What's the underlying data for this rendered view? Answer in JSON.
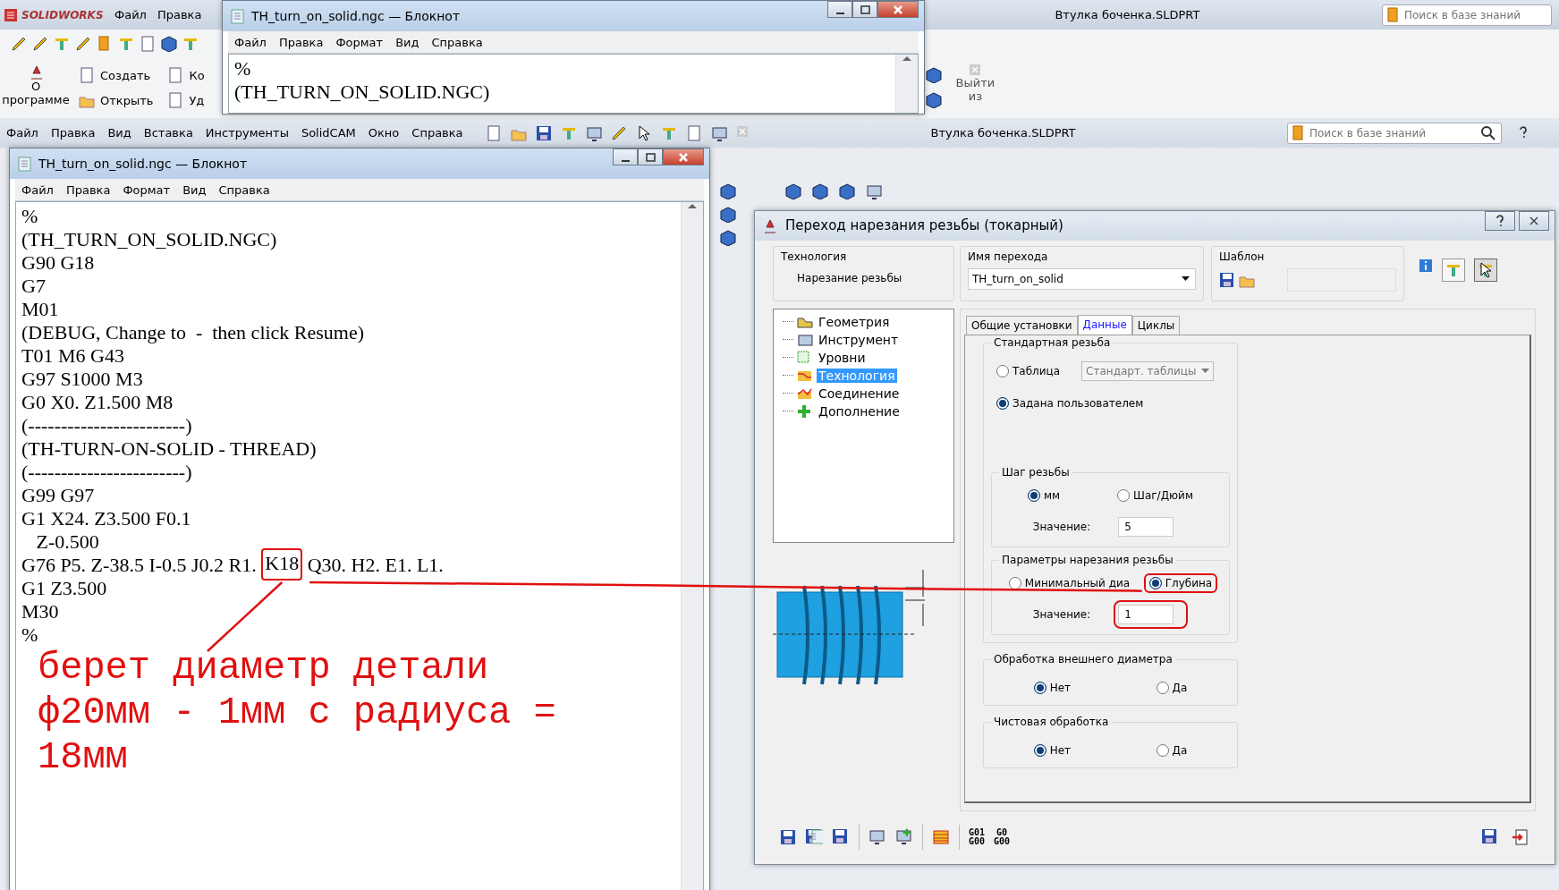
{
  "back_app": {
    "logo": "SOLIDWORKS",
    "menu": [
      "Файл",
      "Правка"
    ],
    "title": "Втулка боченка.SLDPRT",
    "search": {
      "placeholder": "Поиск в базе знаний"
    },
    "ribbon": [
      "Создать",
      "Открыть"
    ],
    "ribbon_cut": [
      "Ко",
      "Уд"
    ],
    "about": "О",
    "about_cut": "программе",
    "exit": [
      "Выйти",
      "из"
    ]
  },
  "back_notepad": {
    "title": "TH_turn_on_solid.ngc — Блокнот",
    "menu": [
      "Файл",
      "Правка",
      "Формат",
      "Вид",
      "Справка"
    ],
    "lines": [
      "%",
      "(TH_TURN_ON_SOLID.NGC)"
    ]
  },
  "app": {
    "menu": [
      "Файл",
      "Правка",
      "Вид",
      "Вставка",
      "Инструменты",
      "SolidCAM",
      "Окно",
      "Справка"
    ],
    "title": "Втулка боченка.SLDPRT",
    "search": {
      "placeholder": "Поиск в базе знаний"
    }
  },
  "notepad": {
    "title": "TH_turn_on_solid.ngc — Блокнот",
    "menu": [
      "Файл",
      "Правка",
      "Формат",
      "Вид",
      "Справка"
    ],
    "lines": [
      {
        "parts": [
          "%"
        ]
      },
      {
        "parts": [
          "(TH_TURN_ON_SOLID.NGC)"
        ]
      },
      {
        "parts": [
          "G90 G18"
        ]
      },
      {
        "parts": [
          "G7"
        ]
      },
      {
        "parts": [
          "M01"
        ]
      },
      {
        "parts": [
          "(DEBUG, Change to  -  then click Resume)"
        ]
      },
      {
        "parts": [
          "T01 M6 G43"
        ]
      },
      {
        "parts": [
          "G97 S1000 M3"
        ]
      },
      {
        "parts": [
          "G0 X0. Z1.500 M8"
        ]
      },
      {
        "parts": [
          "(------------------------)"
        ]
      },
      {
        "parts": [
          "(TH-TURN-ON-SOLID - THREAD)"
        ]
      },
      {
        "parts": [
          "(------------------------)"
        ]
      },
      {
        "parts": [
          "G99 G97"
        ]
      },
      {
        "parts": [
          "G1 X24. Z3.500 F0.1"
        ]
      },
      {
        "parts": [
          "   Z-0.500"
        ]
      },
      {
        "parts": [
          "G76 P5. Z-38.5 I-0.5 J0.2 R1. ",
          "K18",
          " Q30. H2. E1. L1."
        ],
        "circled": [
          false,
          true,
          false
        ]
      },
      {
        "parts": [
          "G1 Z3.500"
        ]
      },
      {
        "parts": [
          "M30"
        ]
      },
      {
        "parts": [
          "%"
        ]
      }
    ]
  },
  "annotation": {
    "note_lines": [
      "берет диаметр детали",
      "ф20мм - 1мм с радиуса =",
      "18мм"
    ]
  },
  "dialog": {
    "title": "Переход нарезания резьбы (токарный)",
    "technology": {
      "label": "Технология",
      "value": "Нарезание резьбы"
    },
    "operation_name": {
      "label": "Имя перехода",
      "value": "TH_turn_on_solid"
    },
    "template": {
      "label": "Шаблон"
    },
    "tree": [
      {
        "label": "Геометрия",
        "selected": false
      },
      {
        "label": "Инструмент",
        "selected": false
      },
      {
        "label": "Уровни",
        "selected": false
      },
      {
        "label": "Технология",
        "selected": true
      },
      {
        "label": "Соединение",
        "selected": false
      },
      {
        "label": "Дополнение",
        "selected": false
      }
    ],
    "tabs": [
      {
        "label": "Общие установки",
        "selected": false
      },
      {
        "label": "Данные",
        "selected": true
      },
      {
        "label": "Циклы",
        "selected": false
      }
    ],
    "sections": [
      {
        "title": "Стандартная резьба",
        "items": [
          {
            "kind": "radio_dropdown",
            "label": "Таблица",
            "checked": false,
            "dropdown": "Стандарт. таблицы",
            "disabled": true
          },
          {
            "kind": "radio",
            "label": "Задана пользователем",
            "checked": true
          },
          {
            "kind": "group",
            "title": "Шаг резьбы",
            "items": [
              {
                "kind": "radio_pair",
                "options": [
                  {
                    "label": "мм",
                    "checked": true,
                    "circled": false
                  },
                  {
                    "label": "Шаг/Дюйм",
                    "checked": false,
                    "circled": false
                  }
                ]
              },
              {
                "kind": "value",
                "label": "Значение:",
                "value": "5",
                "circled": false
              }
            ]
          },
          {
            "kind": "group",
            "title": "Параметры нарезания резьбы",
            "items": [
              {
                "kind": "radio_pair",
                "options": [
                  {
                    "label": "Минимальный диа",
                    "checked": false,
                    "circled": false
                  },
                  {
                    "label": "Глубина",
                    "checked": true,
                    "circled": true
                  }
                ]
              },
              {
                "kind": "value",
                "label": "Значение:",
                "value": "1",
                "circled": true
              }
            ]
          }
        ]
      },
      {
        "title": "Обработка внешнего диаметра",
        "items": [
          {
            "kind": "radio_pair",
            "options": [
              {
                "label": "Нет",
                "checked": true,
                "circled": false
              },
              {
                "label": "Да",
                "checked": false,
                "circled": false
              }
            ]
          }
        ]
      },
      {
        "title": "Чистовая обработка",
        "items": [
          {
            "kind": "radio_pair",
            "options": [
              {
                "label": "Нет",
                "checked": true,
                "circled": false
              },
              {
                "label": "Да",
                "checked": false,
                "circled": false
              }
            ]
          }
        ]
      }
    ],
    "gcode_buttons": [
      {
        "top": "G01",
        "bottom": "G00"
      },
      {
        "top": "G0",
        "bottom": "G00"
      }
    ]
  }
}
